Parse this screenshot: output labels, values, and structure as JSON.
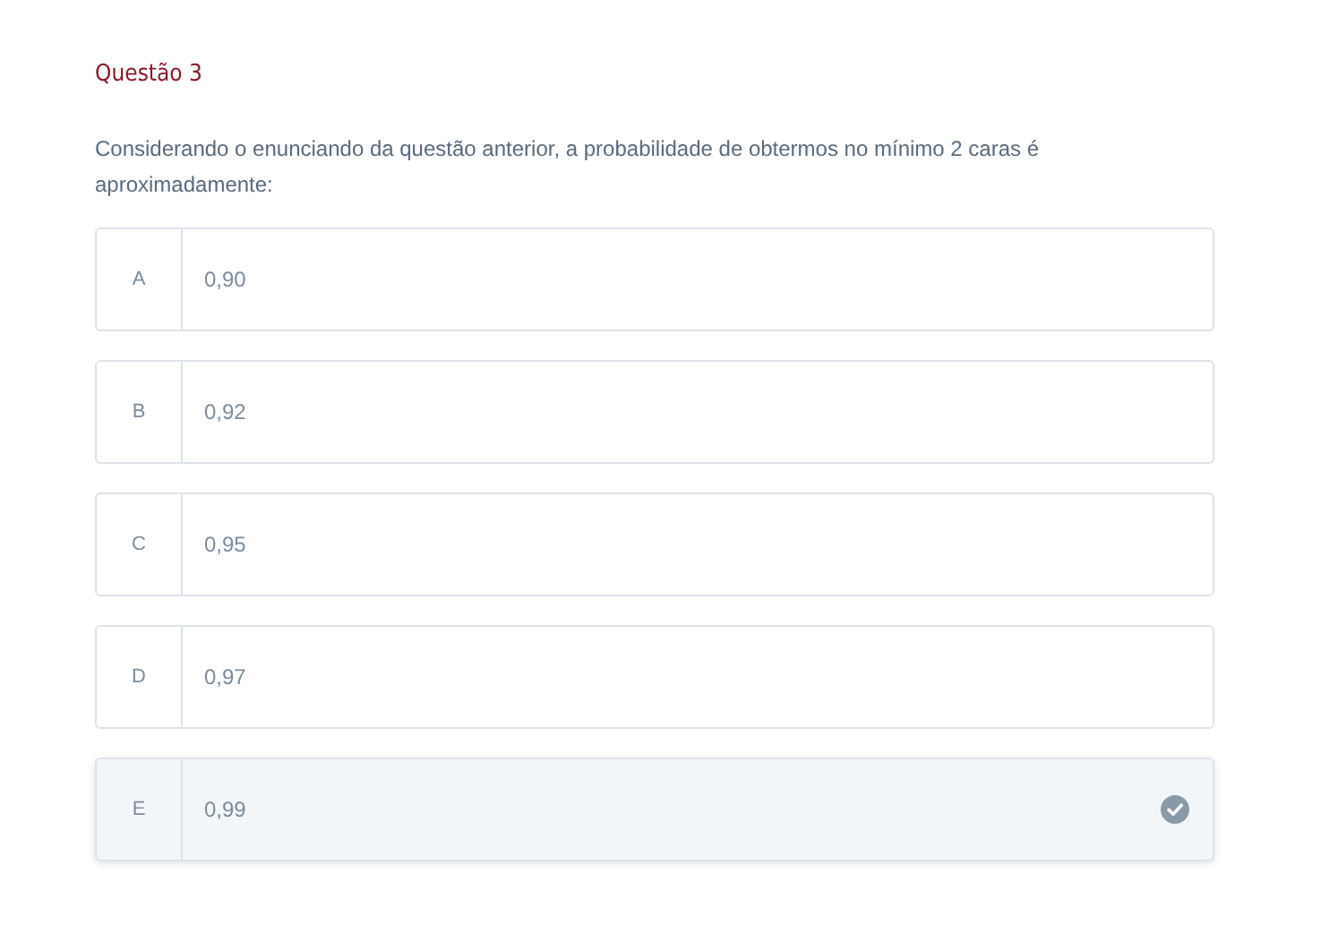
{
  "title": "Questão 3",
  "question": "Considerando o enunciando da questão anterior, a probabilidade de obtermos no mínimo 2 caras é aproximadamente:",
  "options": [
    {
      "letter": "A",
      "text": "0,90",
      "selected": false
    },
    {
      "letter": "B",
      "text": "0,92",
      "selected": false
    },
    {
      "letter": "C",
      "text": "0,95",
      "selected": false
    },
    {
      "letter": "D",
      "text": "0,97",
      "selected": false
    },
    {
      "letter": "E",
      "text": "0,99",
      "selected": true
    }
  ]
}
